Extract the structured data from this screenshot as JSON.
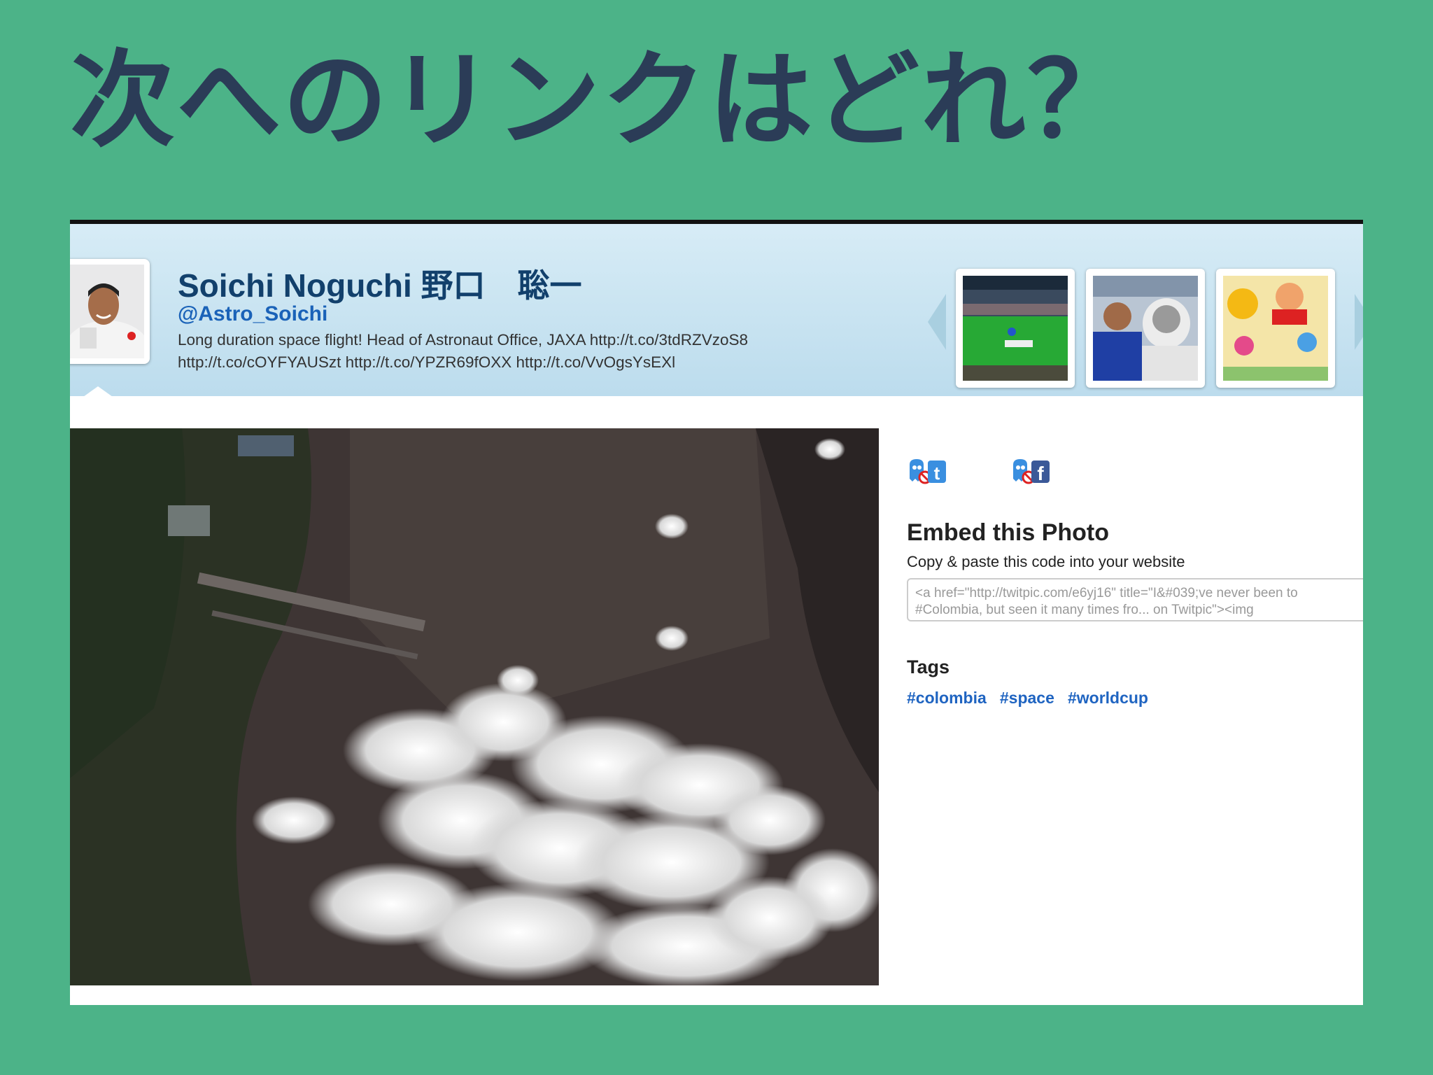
{
  "slide": {
    "title": "次へのリンクはどれ？"
  },
  "profile": {
    "name": "Soichi Noguchi 野口　聡一",
    "handle": "@Astro_Soichi",
    "bio_text": "Long duration space flight! Head of Astronaut Office, JAXA ",
    "links": [
      "http://t.co/3tdRZVzoS8",
      "http://t.co/cOYFYAUSzt",
      "http://t.co/YPZR69fOXX",
      "http://t.co/VvOgsYsEXl"
    ]
  },
  "embed": {
    "title": "Embed this Photo",
    "subtitle": "Copy & paste this code into your website",
    "code_line1": "<a href=\"http://twitpic.com/e6yj16\" title=\"I&#039;ve never been to",
    "code_line2": "#Colombia, but seen it many times fro... on Twitpic\"><img"
  },
  "tags": {
    "title": "Tags",
    "items": [
      "#colombia",
      "#space",
      "#worldcup"
    ]
  },
  "colors": {
    "slide_background": "#4cb388",
    "title_text": "#2b3c57",
    "header_blue": "#cce5f1",
    "name_text": "#12406c",
    "link_blue": "#1a62b8",
    "share_icon_blue": "#3a8fe0",
    "facebook_blue": "#3b5998"
  },
  "icons": {
    "share_twitter": "twitter-share-icon",
    "share_facebook": "facebook-share-icon",
    "carousel_prev": "chevron-left-icon",
    "carousel_next": "chevron-right-icon"
  }
}
